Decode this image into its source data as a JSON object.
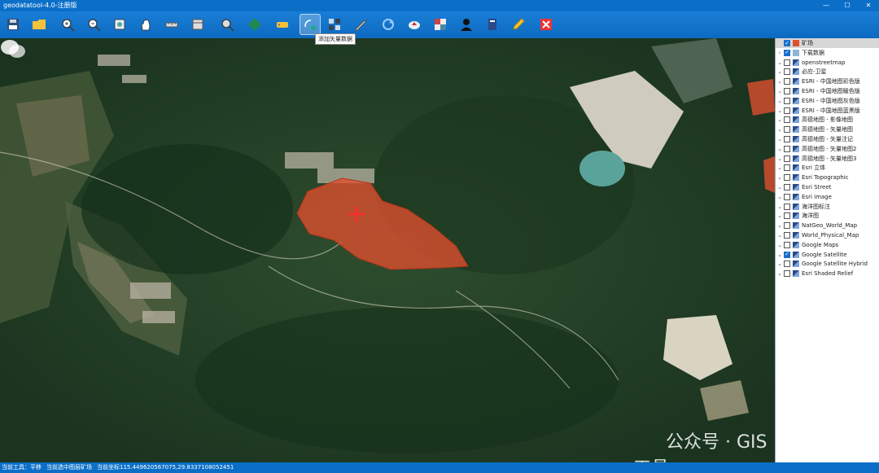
{
  "window": {
    "title": "geodatatool-4.0-注册版"
  },
  "toolbar": {
    "buttons": [
      {
        "id": "save",
        "icon": "save-icon"
      },
      {
        "id": "open",
        "icon": "folder-icon"
      },
      {
        "id": "zoom-in",
        "icon": "zoom-in-icon"
      },
      {
        "id": "zoom-out",
        "icon": "zoom-out-icon"
      },
      {
        "id": "full-extent",
        "icon": "full-extent-icon"
      },
      {
        "id": "pan",
        "icon": "hand-icon"
      },
      {
        "id": "measure",
        "icon": "ruler-icon"
      },
      {
        "id": "measure-area",
        "icon": "area-ruler-icon"
      },
      {
        "id": "search",
        "icon": "search-icon"
      },
      {
        "id": "layer-style",
        "icon": "diamond-icon"
      },
      {
        "id": "tag",
        "icon": "tag-icon"
      },
      {
        "id": "add-vector",
        "icon": "add-vector-icon"
      },
      {
        "id": "grid",
        "icon": "grid-icon"
      },
      {
        "id": "tools",
        "icon": "wrench-icon"
      },
      {
        "id": "refresh",
        "icon": "refresh-icon"
      },
      {
        "id": "cloud",
        "icon": "cloud-upload-icon"
      },
      {
        "id": "tiles",
        "icon": "tiles-icon"
      },
      {
        "id": "user",
        "icon": "user-icon"
      },
      {
        "id": "book",
        "icon": "book-icon"
      },
      {
        "id": "edit",
        "icon": "pencil-icon"
      },
      {
        "id": "close",
        "icon": "close-icon"
      }
    ],
    "tooltip": "添加矢量数据"
  },
  "layers": [
    {
      "label": "矿场",
      "checked": true,
      "expand": "",
      "selected": true,
      "icon": "vector-layer-icon"
    },
    {
      "label": "下载数据",
      "checked": true,
      "expand": ">",
      "selected": false,
      "icon": "download-layer-icon"
    },
    {
      "label": "openstreetmap",
      "checked": false,
      "expand": "v",
      "selected": false,
      "icon": "tile-layer-icon"
    },
    {
      "label": "必应-卫星",
      "checked": false,
      "expand": "v",
      "selected": false,
      "icon": "tile-layer-icon"
    },
    {
      "label": "ESRI - 中国地图彩色版",
      "checked": false,
      "expand": "v",
      "selected": false,
      "icon": "tile-layer-icon"
    },
    {
      "label": "ESRI - 中国地图暖色版",
      "checked": false,
      "expand": "v",
      "selected": false,
      "icon": "tile-layer-icon"
    },
    {
      "label": "ESRI - 中国地图灰色版",
      "checked": false,
      "expand": "v",
      "selected": false,
      "icon": "tile-layer-icon"
    },
    {
      "label": "ESRI - 中国地图蓝黑版",
      "checked": false,
      "expand": "v",
      "selected": false,
      "icon": "tile-layer-icon"
    },
    {
      "label": "高德地图 - 影像地图",
      "checked": false,
      "expand": "v",
      "selected": false,
      "icon": "tile-layer-icon"
    },
    {
      "label": "高德地图 - 矢量地图",
      "checked": false,
      "expand": "v",
      "selected": false,
      "icon": "tile-layer-icon"
    },
    {
      "label": "高德地图 - 矢量注记",
      "checked": false,
      "expand": "v",
      "selected": false,
      "icon": "tile-layer-icon"
    },
    {
      "label": "高德地图 - 矢量地图2",
      "checked": false,
      "expand": "v",
      "selected": false,
      "icon": "tile-layer-icon"
    },
    {
      "label": "高德地图 - 矢量地图3",
      "checked": false,
      "expand": "v",
      "selected": false,
      "icon": "tile-layer-icon"
    },
    {
      "label": "Esri 立体",
      "checked": false,
      "expand": "v",
      "selected": false,
      "icon": "tile-layer-icon"
    },
    {
      "label": "Esri Topographic",
      "checked": false,
      "expand": "v",
      "selected": false,
      "icon": "tile-layer-icon"
    },
    {
      "label": "Esri Street",
      "checked": false,
      "expand": "v",
      "selected": false,
      "icon": "tile-layer-icon"
    },
    {
      "label": "Esri image",
      "checked": false,
      "expand": "v",
      "selected": false,
      "icon": "tile-layer-icon"
    },
    {
      "label": "海洋图标注",
      "checked": false,
      "expand": "v",
      "selected": false,
      "icon": "tile-layer-icon"
    },
    {
      "label": "海洋图",
      "checked": false,
      "expand": "v",
      "selected": false,
      "icon": "tile-layer-icon"
    },
    {
      "label": "NatGeo_World_Map",
      "checked": false,
      "expand": "v",
      "selected": false,
      "icon": "tile-layer-icon"
    },
    {
      "label": "World_Physical_Map",
      "checked": false,
      "expand": "v",
      "selected": false,
      "icon": "tile-layer-icon"
    },
    {
      "label": "Google Maps",
      "checked": false,
      "expand": "v",
      "selected": false,
      "icon": "tile-layer-icon"
    },
    {
      "label": "Google Satellite",
      "checked": true,
      "expand": "v",
      "selected": false,
      "icon": "tile-layer-icon"
    },
    {
      "label": "Google Satellite Hybrid",
      "checked": false,
      "expand": "v",
      "selected": false,
      "icon": "tile-layer-icon"
    },
    {
      "label": "Esri Shaded Relief",
      "checked": false,
      "expand": "v",
      "selected": false,
      "icon": "tile-layer-icon"
    }
  ],
  "status": {
    "tool": "当前工具：平移",
    "layer": "当前选中图层矿场",
    "coords": "当前坐标115.449620567075,29.8337108052451"
  },
  "watermark": {
    "text": "公众号 · GIS工具"
  },
  "colors": {
    "accent": "#0b6fc8",
    "polygon": "#e0502f",
    "marker": "#ff2b2b"
  }
}
